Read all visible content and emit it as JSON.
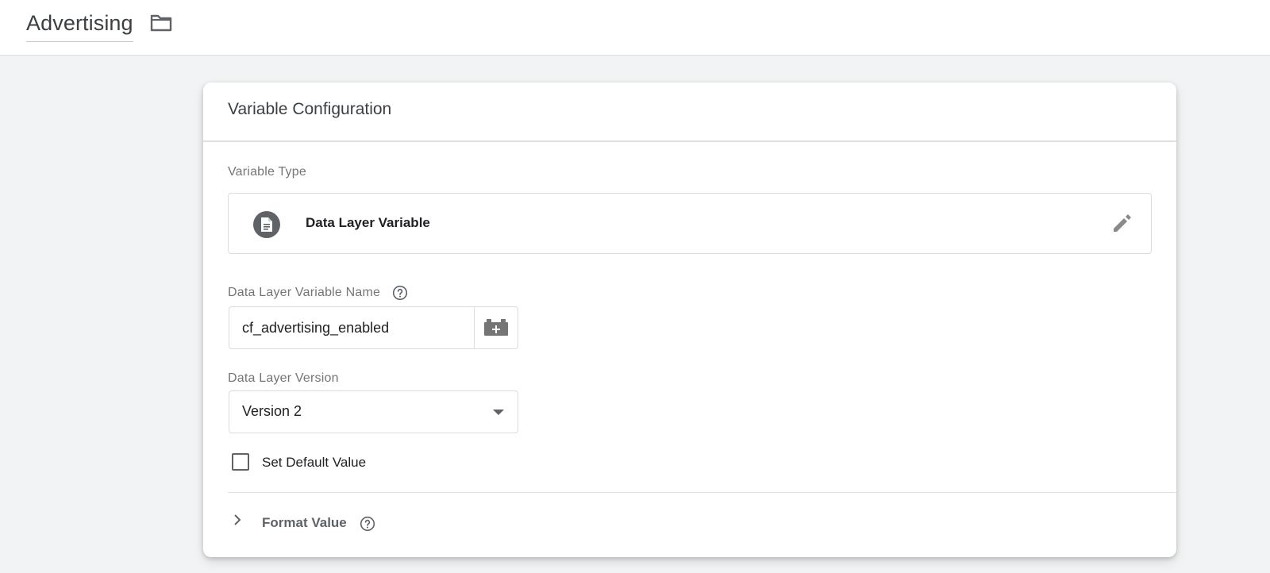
{
  "header": {
    "title": "Advertising",
    "folder_icon": "folder-icon"
  },
  "card": {
    "title": "Variable Configuration",
    "variable_type": {
      "label": "Variable Type",
      "name": "Data Layer Variable",
      "icon": "document-icon",
      "edit_icon": "pencil-icon"
    },
    "dlv_name": {
      "label": "Data Layer Variable Name",
      "help_icon": "help-icon",
      "value": "cf_advertising_enabled",
      "picker_icon": "variable-picker-icon"
    },
    "dl_version": {
      "label": "Data Layer Version",
      "selected": "Version 2"
    },
    "default_value": {
      "label": "Set Default Value",
      "checked": false
    },
    "format_value": {
      "label": "Format Value",
      "expanded": false
    }
  },
  "colors": {
    "page_bg": "#f1f3f4",
    "card_bg": "#ffffff",
    "icon_grey": "#5f6368",
    "label_grey": "#757575",
    "border": "#dadce0"
  }
}
